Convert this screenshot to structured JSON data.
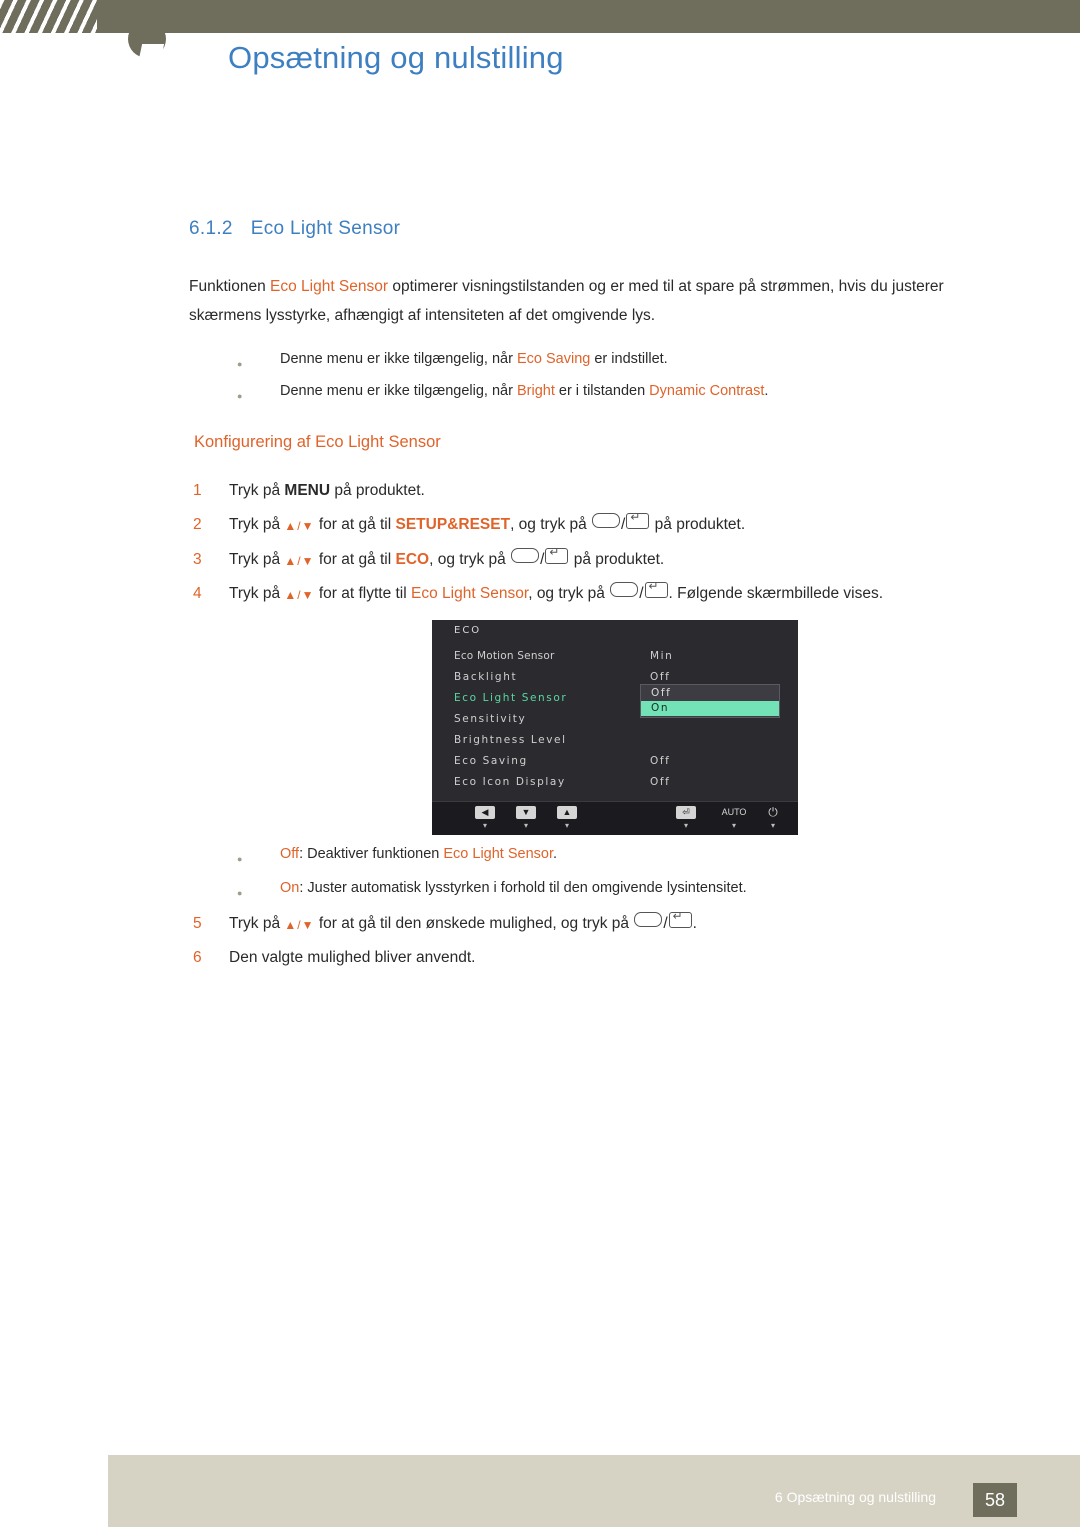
{
  "header": {
    "title": "Opsætning og nulstilling",
    "logo_icon": "samsung-logo-mark"
  },
  "section": {
    "number": "6.1.2",
    "title": "Eco Light Sensor"
  },
  "intro": {
    "part1": "Funktionen ",
    "term1": "Eco Light Sensor",
    "part2": " optimerer visningstilstanden og er med til at spare på strømmen, hvis du justerer skærmens lysstyrke, afhængigt af intensiteten af det omgivende lys."
  },
  "notes": [
    {
      "pre": "Denne menu er ikke tilgængelig, når ",
      "term": "Eco Saving",
      "post": " er indstillet."
    },
    {
      "pre": "Denne menu er ikke tilgængelig, når ",
      "term": "Bright",
      "mid": " er i tilstanden ",
      "term2": "Dynamic Contrast",
      "post": "."
    }
  ],
  "config_heading": "Konfigurering af Eco Light Sensor",
  "steps": [
    {
      "num": "1",
      "pre": "Tryk på ",
      "key": "MENU",
      "post": " på produktet."
    },
    {
      "num": "2",
      "pre": "Tryk på ",
      "arrows": "▲/▼",
      "mid": " for at gå til ",
      "term": "SETUP&RESET",
      "mid2": ", og tryk på ",
      "post": " på produktet."
    },
    {
      "num": "3",
      "pre": "Tryk på ",
      "arrows": "▲/▼",
      "mid": " for at gå til ",
      "term": "ECO",
      "mid2": ", og tryk på ",
      "post": " på produktet."
    },
    {
      "num": "4",
      "pre": "Tryk på ",
      "arrows": "▲/▼",
      "mid": " for at flytte til ",
      "term": "Eco Light Sensor",
      "mid2": ", og tryk på ",
      "post": ". Følgende skærmbillede vises."
    },
    {
      "num": "5",
      "pre": "Tryk på ",
      "arrows": "▲/▼",
      "mid": " for at gå til den ønskede mulighed, og tryk på ",
      "post": "."
    },
    {
      "num": "6",
      "text": "Den valgte mulighed bliver anvendt."
    }
  ],
  "osd": {
    "title": "ECO",
    "rows": [
      {
        "label": "Eco Motion Sensor",
        "value": "Min",
        "style": "plain"
      },
      {
        "label": "Backlight",
        "value": "Off",
        "style": "enc"
      },
      {
        "label": "Eco Light Sensor",
        "value": "",
        "style": "enc-green"
      },
      {
        "label": "Sensitivity",
        "value": "",
        "style": "enc"
      },
      {
        "label": "Brightness Level",
        "value": "",
        "style": "enc"
      },
      {
        "label": "Eco Saving",
        "value": "Off",
        "style": "enc"
      },
      {
        "label": "Eco Icon Display",
        "value": "Off",
        "style": "enc"
      }
    ],
    "option_off": "Off",
    "option_on": "On",
    "buttons": [
      {
        "name": "left",
        "glyph": "◀",
        "tick": "▾"
      },
      {
        "name": "down",
        "glyph": "▼",
        "tick": "▾"
      },
      {
        "name": "up",
        "glyph": "▲",
        "tick": "▾"
      },
      {
        "name": "enter",
        "glyph": "⏎",
        "tick": "▾"
      },
      {
        "name": "auto",
        "glyph": "AUTO",
        "tick": "▾"
      },
      {
        "name": "power",
        "glyph": "⏻",
        "tick": "▾"
      }
    ]
  },
  "options": [
    {
      "label": "Off",
      "pre": ": Deaktiver funktionen ",
      "term": "Eco Light Sensor",
      "post": "."
    },
    {
      "label": "On",
      "pre": ": Juster automatisk lysstyrken i forhold til den omgivende lysintensitet.",
      "term": "",
      "post": ""
    }
  ],
  "footer": {
    "text": "6 Opsætning og nulstilling",
    "page": "58"
  },
  "colors": {
    "accent_blue": "#3d7fc1",
    "accent_orange": "#e0632a",
    "bar_olive": "#6f6d5c",
    "footer_band": "#d6d3c4",
    "osd_bg": "#2b2b2f",
    "osd_highlight": "#73e2b6"
  }
}
